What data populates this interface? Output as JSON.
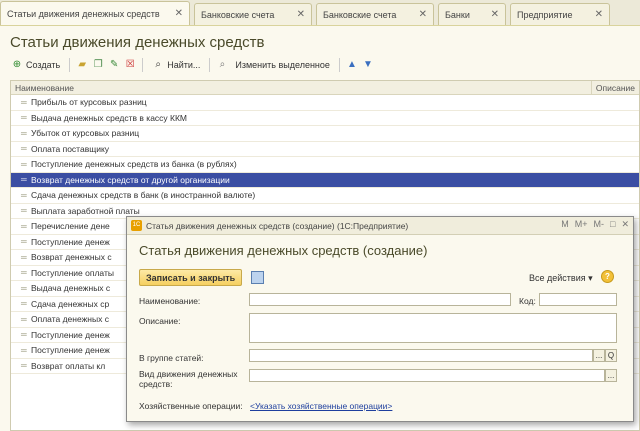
{
  "tabs": [
    {
      "label": "Статьи движения денежных средств",
      "active": true
    },
    {
      "label": "Банковские счета",
      "active": false
    },
    {
      "label": "Банковские счета",
      "active": false
    },
    {
      "label": "Банки",
      "active": false
    },
    {
      "label": "Предприятие",
      "active": false
    }
  ],
  "page_title": "Статьи движения денежных средств",
  "toolbar": {
    "create_label": "Создать",
    "find_label": "Найти...",
    "change_selected_label": "Изменить выделенное"
  },
  "table": {
    "columns": [
      "Наименование",
      "Описание"
    ],
    "rows": [
      "Прибыль от курсовых разниц",
      "Выдача денежных средств в кассу ККМ",
      "Убыток от курсовых разниц",
      "Оплата поставщику",
      "Поступление денежных средств из банка (в рублях)",
      "Возврат денежных средств от другой организации",
      "Сдача денежных средств в банк (в иностранной валюте)",
      "Выплата заработной платы",
      "Перечисление дене",
      "Поступление денеж",
      "Возврат денежных с",
      "Поступление оплаты",
      "Выдача денежных с",
      "Сдача денежных ср",
      "Оплата денежных с",
      "Поступление денеж",
      "Поступление денеж",
      "Возврат оплаты кл"
    ],
    "selected_index": 5
  },
  "dialog": {
    "window_title": "Статья движения денежных средств (создание)  (1С:Предприятие)",
    "window_tools": [
      "M",
      "M+",
      "M-",
      "□",
      "✕"
    ],
    "heading": "Статья движения денежных средств (создание)",
    "save_close_label": "Записать и закрыть",
    "all_actions_label": "Все действия ▾",
    "help_symbol": "?",
    "name_label": "Наименование:",
    "code_label": "Код:",
    "description_label": "Описание:",
    "group_label": "В группе статей:",
    "movement_type_label": "Вид движения денежных средств:",
    "ops_label": "Хозяйственные операции:",
    "ops_link": "<Указать хозяйственные операции>",
    "dots": "...",
    "search_symbol": "Q"
  },
  "colors": {
    "selected_row": "#3b4ea3",
    "accent_button": "#f5cf60",
    "link": "#1e3f9e"
  }
}
